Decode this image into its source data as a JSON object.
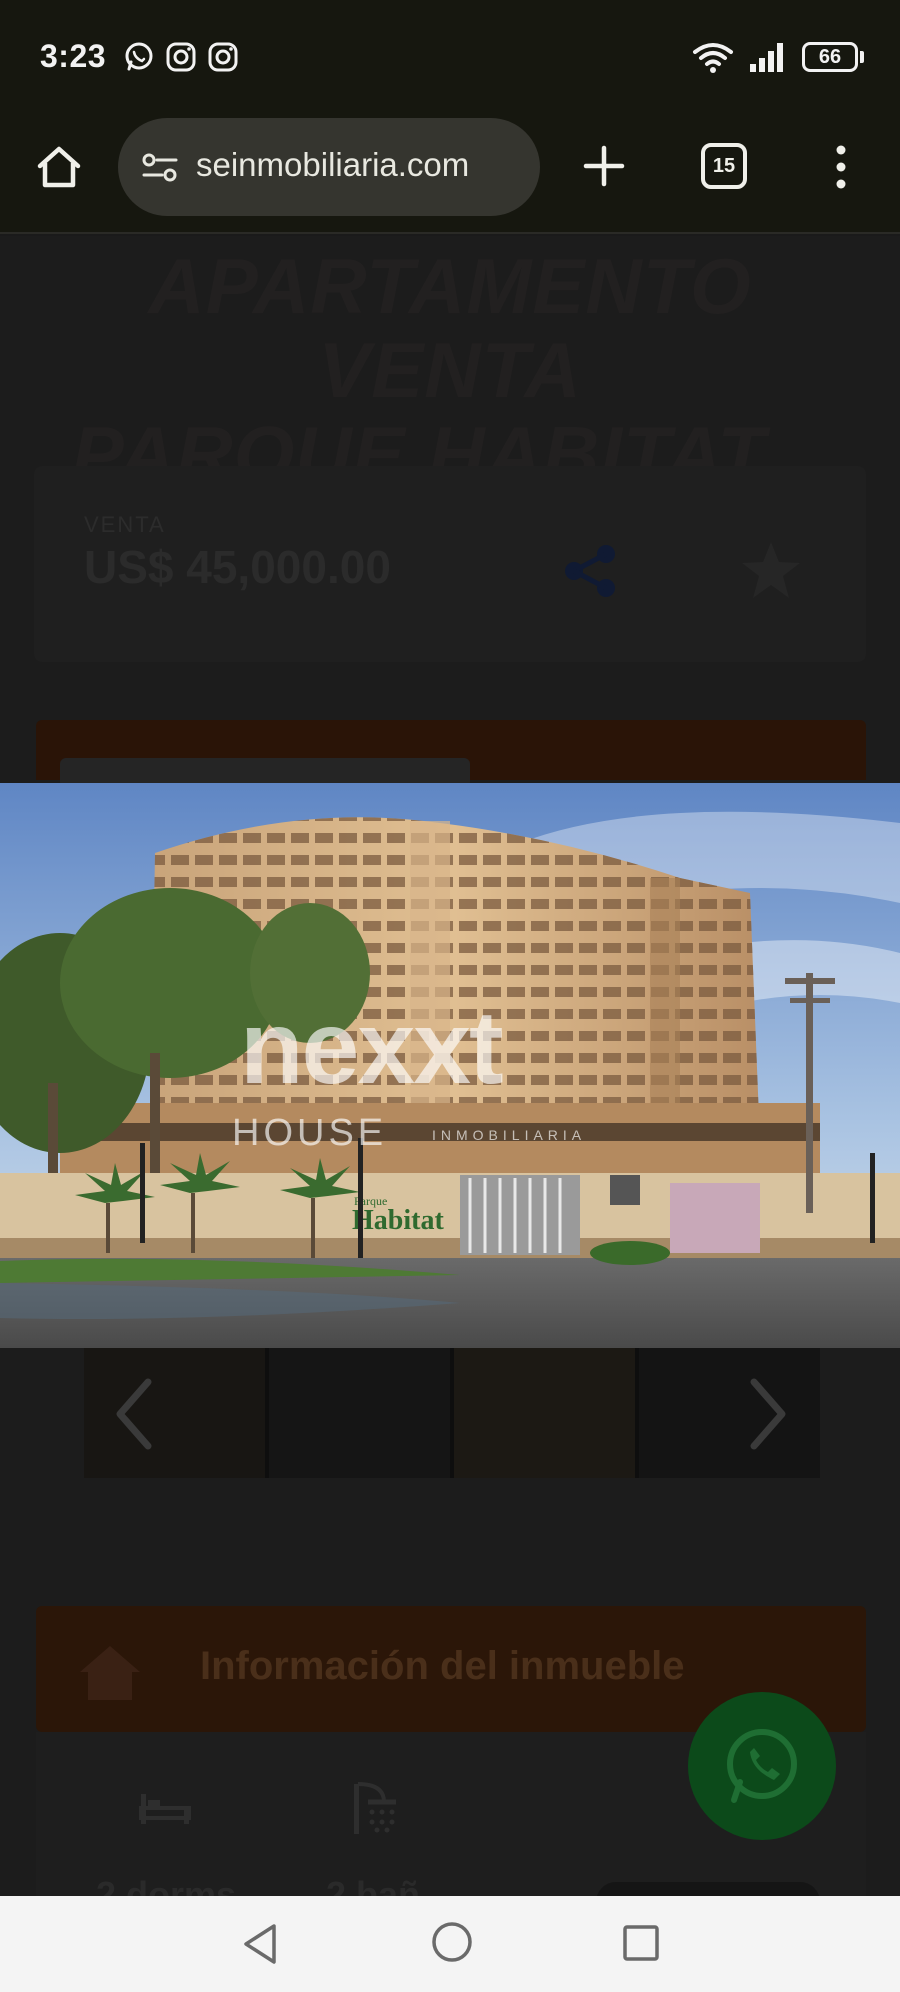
{
  "status_bar": {
    "time": "3:23",
    "apps": [
      "whatsapp-icon",
      "instagram-icon",
      "instagram-icon"
    ],
    "battery": "66"
  },
  "browser": {
    "url": "seinmobiliaria.com",
    "tab_count": "15"
  },
  "listing": {
    "title_line1": "APARTAMENTO VENTA",
    "title_line2": "PARQUE HABITAT...",
    "price_label": "VENTA",
    "price": "US$ 45,000.00"
  },
  "photo": {
    "watermark_logo": "nexxt",
    "watermark_brand": "HOUSE",
    "watermark_sub": "INMOBILIARIA",
    "sign_small": "Parque",
    "sign_text": "Habitat"
  },
  "info": {
    "section_title": "Información del inmueble",
    "dorms": "2 dorms",
    "banos": "2 bañ"
  },
  "colors": {
    "brand_orange": "#e8730f",
    "whatsapp_green": "#25d366"
  }
}
